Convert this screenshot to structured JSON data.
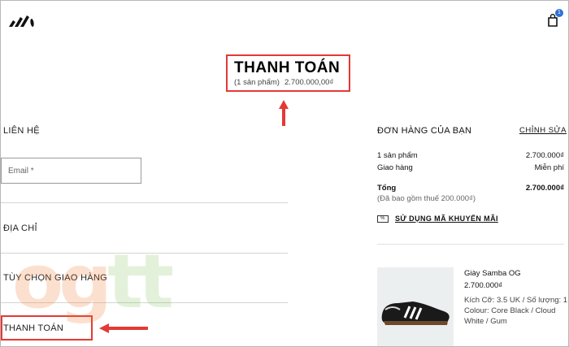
{
  "header": {
    "logo": "adidas-trefoil-logo",
    "cart_count": "1"
  },
  "checkout": {
    "title": "THANH TOÁN",
    "item_count": "(1 sản phẩm)",
    "total": "2.700.000,00₫"
  },
  "contact": {
    "heading": "LIÊN HỆ",
    "email_placeholder": "Email *"
  },
  "sections": {
    "address": "ĐỊA CHỈ",
    "shipping": "TÙY CHỌN GIAO HÀNG",
    "payment": "THANH TOÁN"
  },
  "order": {
    "heading": "ĐƠN HÀNG CỦA BẠN",
    "edit": "CHỈNH SỬA",
    "items_label": "1 sản phẩm",
    "items_value": "2.700.000₫",
    "shipping_label": "Giao hàng",
    "shipping_value": "Miễn phí",
    "total_label": "Tổng",
    "total_value": "2.700.000₫",
    "tax_note": "(Đã bao gồm thuế 200.000₫)",
    "promo": "SỬ DỤNG MÃ KHUYẾN MÃI"
  },
  "product": {
    "name": "Giày Samba OG",
    "price": "2.700.000₫",
    "size": "Kích Cỡ: 3.5 UK / Số lượng: 1",
    "colour_line1": "Colour: Core Black / Cloud",
    "colour_line2": "White / Gum"
  },
  "watermark": "ogtt",
  "colors": {
    "highlight": "#e53935",
    "badge": "#2c70d8"
  }
}
